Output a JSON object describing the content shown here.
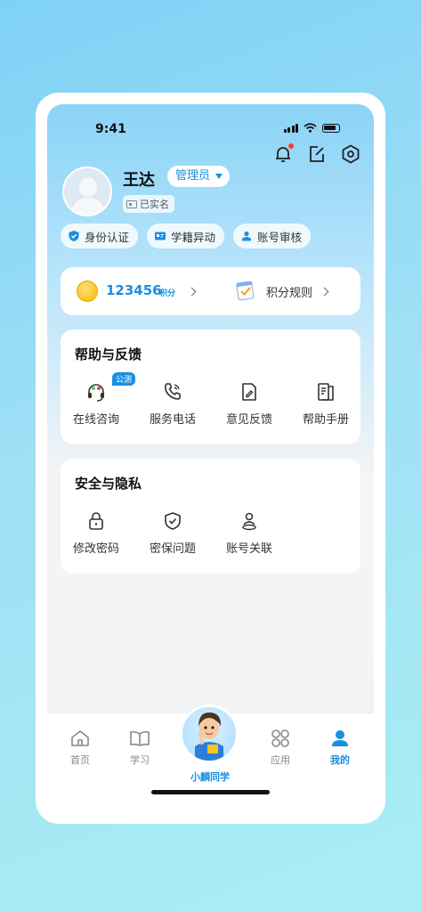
{
  "status_bar": {
    "time": "9:41"
  },
  "profile": {
    "name": "王达",
    "role": "管理员",
    "verified_label": "已实名"
  },
  "quick_chips": [
    {
      "label": "身份认证",
      "icon": "shield-check-icon"
    },
    {
      "label": "学籍异动",
      "icon": "id-card-icon"
    },
    {
      "label": "账号审核",
      "icon": "user-stamp-icon"
    }
  ],
  "points": {
    "value": "123456",
    "unit": "积分",
    "rules_label": "积分规则"
  },
  "help": {
    "title": "帮助与反馈",
    "beta_tag": "公测",
    "items": [
      {
        "label": "在线咨询",
        "icon": "headset-icon"
      },
      {
        "label": "服务电话",
        "icon": "phone-icon"
      },
      {
        "label": "意见反馈",
        "icon": "feedback-icon"
      },
      {
        "label": "帮助手册",
        "icon": "manual-icon"
      }
    ]
  },
  "security": {
    "title": "安全与隐私",
    "items": [
      {
        "label": "修改密码",
        "icon": "lock-icon"
      },
      {
        "label": "密保问题",
        "icon": "shield-icon"
      },
      {
        "label": "账号关联",
        "icon": "link-user-icon"
      }
    ]
  },
  "tabbar": {
    "items": [
      {
        "label": "首页",
        "icon": "home-icon"
      },
      {
        "label": "学习",
        "icon": "book-icon"
      },
      {
        "label": "小麟同学",
        "icon": "mascot-icon"
      },
      {
        "label": "应用",
        "icon": "apps-icon"
      },
      {
        "label": "我的",
        "icon": "user-icon"
      }
    ],
    "active": "我的"
  },
  "colors": {
    "accent": "#1a8fe0",
    "notification": "#ff3b30"
  }
}
